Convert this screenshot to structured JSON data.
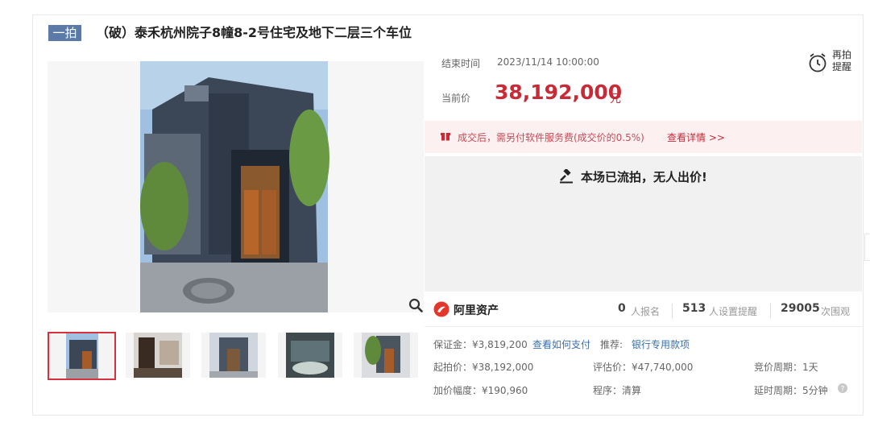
{
  "header": {
    "badge": "一拍",
    "title": "（破）泰禾杭州院子8幢8-2号住宅及地下二层三个车位"
  },
  "auction": {
    "end_time_label": "结束时间",
    "end_time": "2023/11/14 10:00:00",
    "current_price_label": "当前价",
    "current_price": "38,192,000",
    "currency_unit": "元",
    "remind_label_line1": "再拍",
    "remind_label_line2": "提醒"
  },
  "notice": {
    "text": "成交后，需另付软件服务费(成交价的0.5%)",
    "link": "查看详情 >>"
  },
  "status": {
    "text": "本场已流拍，无人出价!"
  },
  "stats": {
    "brand": "阿里资产",
    "signups": "0",
    "signups_label": "人报名",
    "reminders": "513",
    "reminders_label": "人设置提醒",
    "views": "29005",
    "views_label": "次围观"
  },
  "details": {
    "deposit": "保证金：¥3,819,200",
    "deposit_link": "查看如何支付",
    "recommend_label": "推荐:",
    "recommend_link": "银行专用款项",
    "start_price": "起拍价：¥38,192,000",
    "eval_price": "评估价：¥47,740,000",
    "bid_period": "竞价周期：1天",
    "increment": "加价幅度：¥190,960",
    "procedure": "程序：清算",
    "delay_period": "延时周期：5分钟"
  },
  "colors": {
    "accent": "#c82a36",
    "badge": "#5b7aa8",
    "link": "#3a6fb0"
  }
}
